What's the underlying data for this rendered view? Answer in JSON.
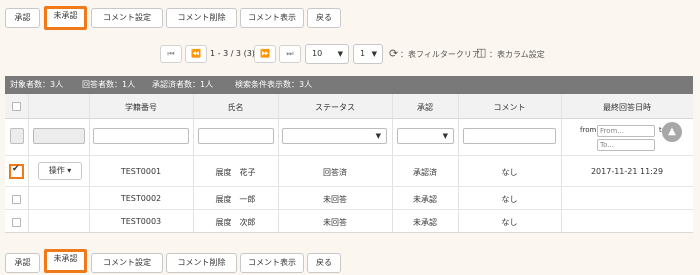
{
  "toolbar": {
    "approve": "承認",
    "unapprove": "未承認",
    "comment_settings": "コメント設定",
    "comment_delete": "コメント削除",
    "comment_show": "コメント表示",
    "back": "戻る"
  },
  "pagination": {
    "first": "⏮",
    "prev": "⏪",
    "range": "1 - 3 / 3 (3)",
    "next": "⏩",
    "last": "⏭",
    "per_page": "10",
    "page": "1",
    "filter_clear_icon": "⟳",
    "filter_clear": "：表フィルタークリア",
    "column_settings_icon": "◫",
    "column_settings": "：表カラム設定"
  },
  "info": {
    "targets": "対象者数：3人",
    "answered": "回答者数：1人",
    "approved": "承認済者数：1人",
    "search_results": "検索条件表示数：3人"
  },
  "table": {
    "headers": {
      "student_id": "学籍番号",
      "name": "氏名",
      "status": "ステータス",
      "approval": "承認",
      "comment": "コメント",
      "last_answer": "最終回答日時"
    },
    "filters": {
      "from_label": "from",
      "from_placeholder": "From...",
      "to_label": "to",
      "to_placeholder": "To..."
    },
    "rows": [
      {
        "action": "操作 ▾",
        "student_id": "TEST0001",
        "name": "展度　花子",
        "status": "回答済",
        "approval": "承認済",
        "comment": "なし",
        "last_answer": "2017-11-21 11:29"
      },
      {
        "student_id": "TEST0002",
        "name": "展度　一郎",
        "status": "未回答",
        "approval": "未承認",
        "comment": "なし",
        "last_answer": ""
      },
      {
        "student_id": "TEST0003",
        "name": "展度　次郎",
        "status": "未回答",
        "approval": "未承認",
        "comment": "なし",
        "last_answer": ""
      }
    ]
  },
  "colors": {
    "highlight": "#f07a1a",
    "info_bar": "#797979"
  }
}
